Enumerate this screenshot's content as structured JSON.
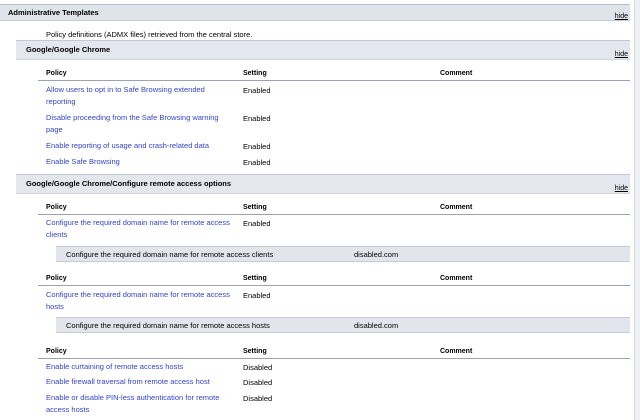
{
  "admin": {
    "title": "Administrative Templates",
    "hide": "hide",
    "description": "Policy definitions (ADMX files) retrieved from the central store."
  },
  "columns": {
    "policy": "Policy",
    "setting": "Setting",
    "comment": "Comment"
  },
  "chrome": {
    "title": "Google/Google Chrome",
    "hide": "hide",
    "policies": [
      {
        "name": "Allow users to opt in to Safe Browsing extended reporting",
        "setting": "Enabled"
      },
      {
        "name": "Disable proceeding from the Safe Browsing warning page",
        "setting": "Enabled"
      },
      {
        "name": "Enable reporting of usage and crash-related data",
        "setting": "Enabled"
      },
      {
        "name": "Enable Safe Browsing",
        "setting": "Enabled"
      }
    ]
  },
  "remote": {
    "title": "Google/Google Chrome/Configure remote access options",
    "hide": "hide",
    "block1": {
      "name": "Configure the required domain name for remote access clients",
      "setting": "Enabled",
      "detail_label": "Configure the required domain name for remote access clients",
      "detail_value": "disabled.com"
    },
    "block2": {
      "name": "Configure the required domain name for remote access hosts",
      "setting": "Enabled",
      "detail_label": "Configure the required domain name for remote access hosts",
      "detail_value": "disabled.com"
    },
    "block3": [
      {
        "name": "Enable curtaining of remote access hosts",
        "setting": "Disabled"
      },
      {
        "name": "Enable firewall traversal from remote access host",
        "setting": "Disabled"
      },
      {
        "name": "Enable or disable PIN-less authentication for remote access hosts",
        "setting": "Disabled"
      }
    ]
  }
}
